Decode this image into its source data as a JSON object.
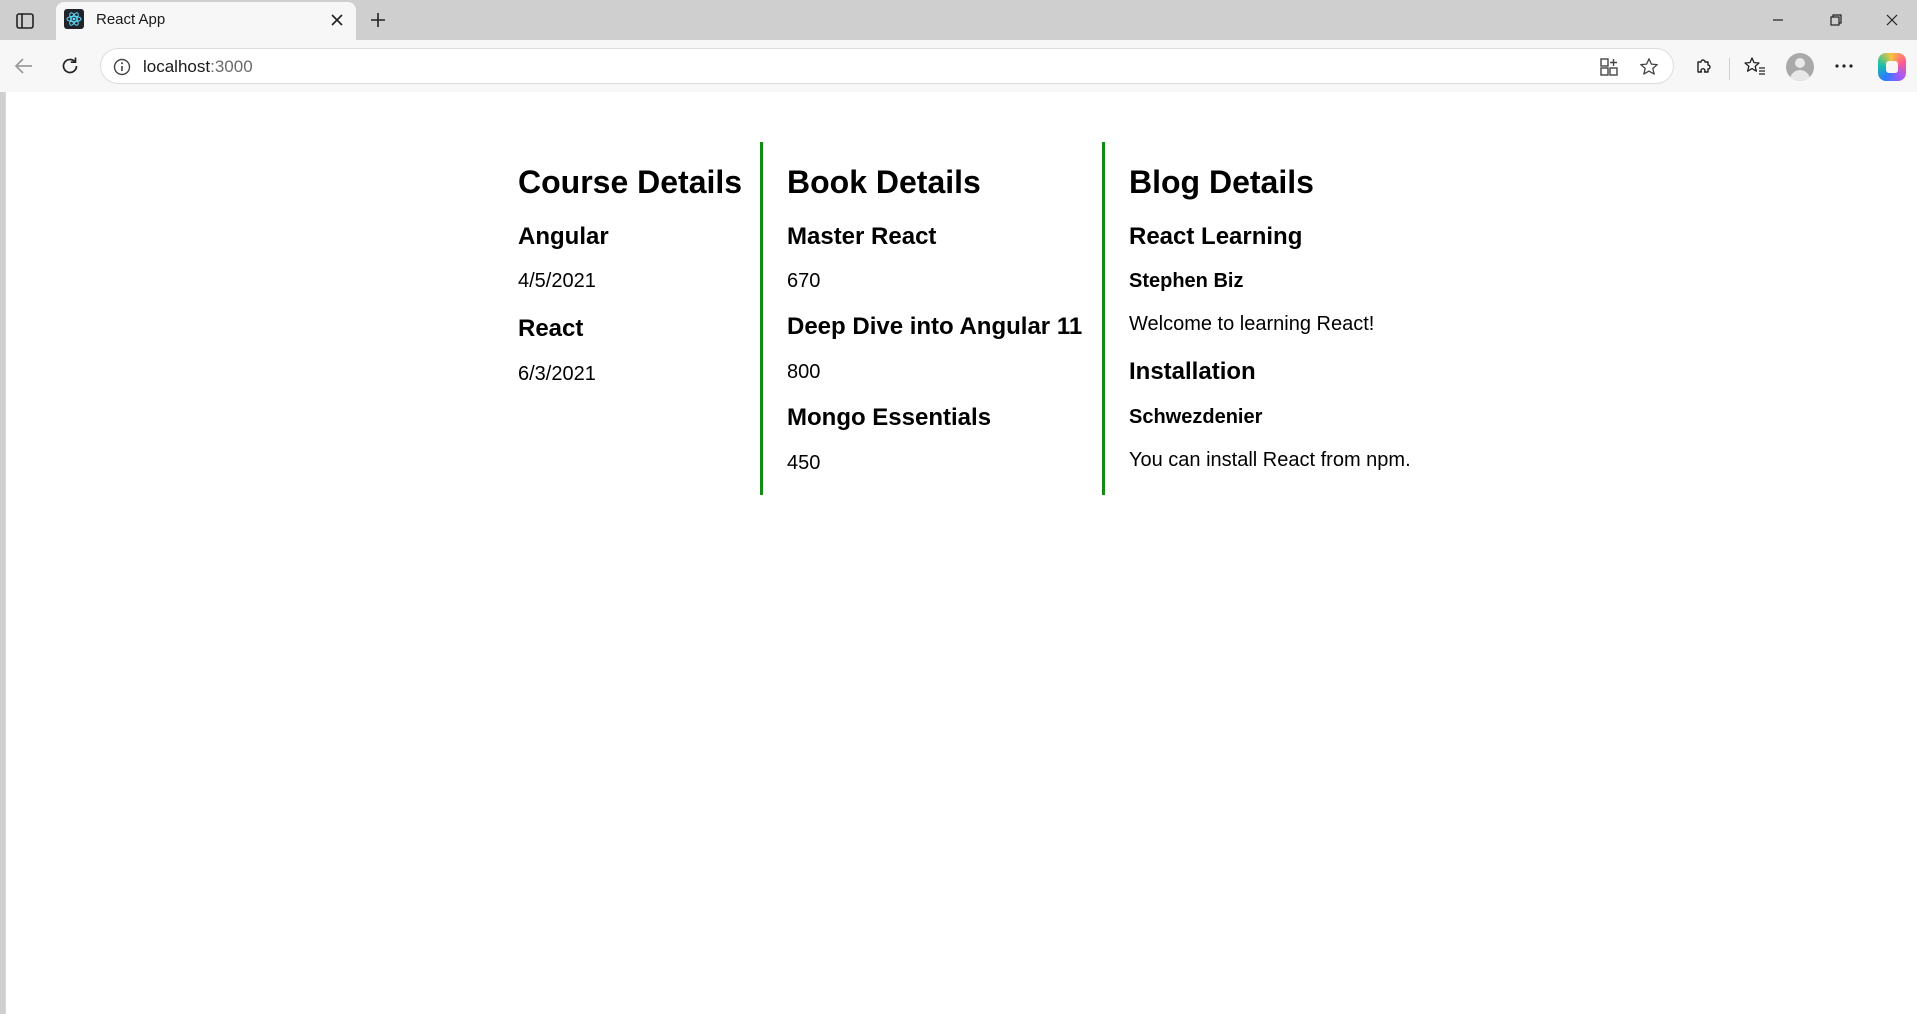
{
  "browser": {
    "tab": {
      "title": "React App"
    },
    "address": {
      "host": "localhost",
      "port": ":3000"
    },
    "colors": {
      "accent_border": "#138a13",
      "tab_strip": "#cfcfcf",
      "toolbar": "#f7f7f7"
    }
  },
  "page": {
    "courses": {
      "heading": "Course Details",
      "items": [
        {
          "name": "Angular",
          "date": "4/5/2021"
        },
        {
          "name": "React",
          "date": "6/3/2021"
        }
      ]
    },
    "books": {
      "heading": "Book Details",
      "items": [
        {
          "name": "Master React",
          "price": "670"
        },
        {
          "name": "Deep Dive into Angular 11",
          "price": "800"
        },
        {
          "name": "Mongo Essentials",
          "price": "450"
        }
      ]
    },
    "blogs": {
      "heading": "Blog Details",
      "items": [
        {
          "title": "React Learning",
          "author": "Stephen Biz",
          "content": "Welcome to learning React!"
        },
        {
          "title": "Installation",
          "author": "Schwezdenier",
          "content": "You can install React from npm."
        }
      ]
    }
  }
}
